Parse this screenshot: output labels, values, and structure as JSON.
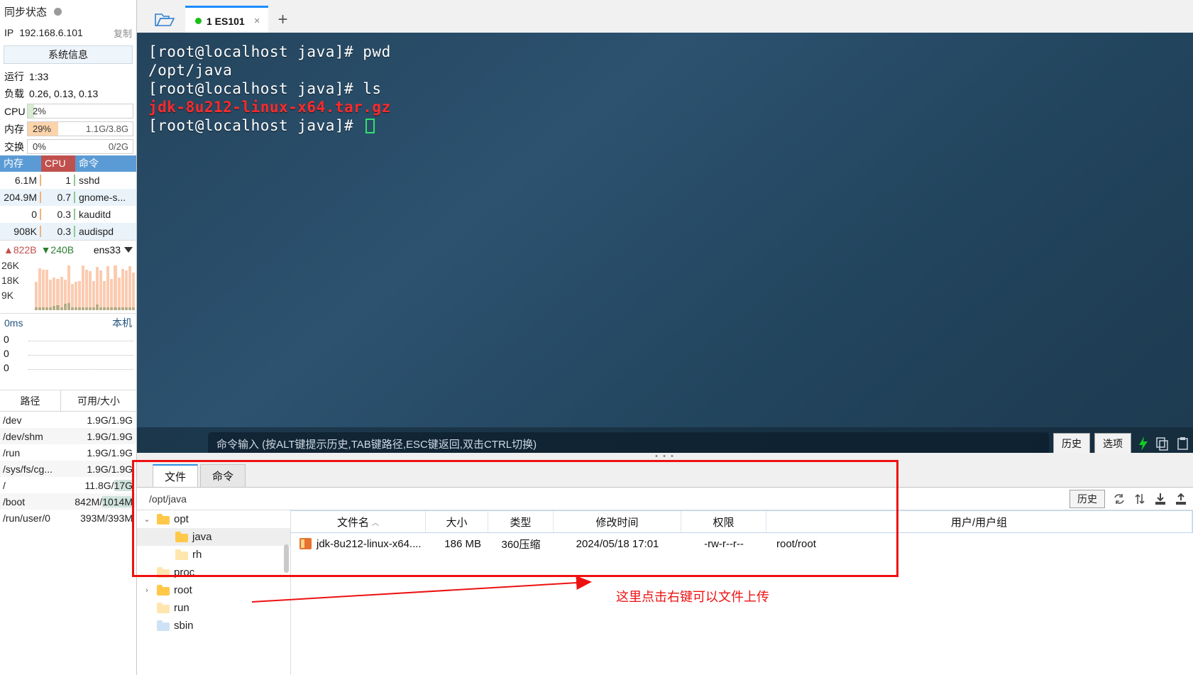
{
  "sidebar": {
    "sync_label": "同步状态",
    "ip_label": "IP",
    "ip_value": "192.168.6.101",
    "copy_label": "复制",
    "sysinfo_button": "系统信息",
    "uptime_label": "运行",
    "uptime_value": "1:33",
    "load_label": "负载",
    "load_value": "0.26, 0.13, 0.13",
    "meters": [
      {
        "label": "CPU",
        "pct": "2%",
        "right": "",
        "fill": "#d7ecd2",
        "width": "6%"
      },
      {
        "label": "内存",
        "pct": "29%",
        "right": "1.1G/3.8G",
        "fill": "#fbd4ab",
        "width": "29%"
      },
      {
        "label": "交换",
        "pct": "0%",
        "right": "0/2G",
        "fill": "#ffffff",
        "width": "0%"
      }
    ],
    "proc_headers": [
      "内存",
      "CPU",
      "命令"
    ],
    "processes": [
      {
        "mem": "6.1M",
        "cpu": "1",
        "cmd": "sshd"
      },
      {
        "mem": "204.9M",
        "cpu": "0.7",
        "cmd": "gnome-s..."
      },
      {
        "mem": "0",
        "cpu": "0.3",
        "cmd": "kauditd"
      },
      {
        "mem": "908K",
        "cpu": "0.3",
        "cmd": "audispd"
      }
    ],
    "net": {
      "up": "822B",
      "down": "240B",
      "interface": "ens33",
      "y_labels": [
        "26K",
        "18K",
        "9K"
      ]
    },
    "latency": {
      "unit": "0ms",
      "local_label": "本机",
      "y_labels": [
        "0",
        "0",
        "0"
      ]
    },
    "disk_headers": [
      "路径",
      "可用/大小"
    ],
    "disks": [
      {
        "path": "/dev",
        "size": "1.9G/1.9G",
        "hl": ""
      },
      {
        "path": "/dev/shm",
        "size": "1.9G/1.9G",
        "hl": ""
      },
      {
        "path": "/run",
        "size": "1.9G/1.9G",
        "hl": ""
      },
      {
        "path": "/sys/fs/cg...",
        "size": "1.9G/1.9G",
        "hl": ""
      },
      {
        "path": "/",
        "size": "11.8G/17G",
        "hl": "17G"
      },
      {
        "path": "/boot",
        "size": "842M/1014M",
        "hl": "1014M"
      },
      {
        "path": "/run/user/0",
        "size": "393M/393M",
        "hl": ""
      }
    ]
  },
  "tabbar": {
    "folder_icon": "open-folder-icon",
    "tab_label": "1 ES101",
    "close_icon": "×",
    "new_tab_icon": "+"
  },
  "terminal": {
    "lines": [
      {
        "text": "[root@localhost java]# pwd",
        "color": "white"
      },
      {
        "text": "/opt/java",
        "color": "white"
      },
      {
        "text": "[root@localhost java]# ls",
        "color": "white"
      },
      {
        "text": "jdk-8u212-linux-x64.tar.gz",
        "color": "red"
      },
      {
        "text": "[root@localhost java]# ",
        "color": "white"
      }
    ],
    "input_placeholder": "命令输入 (按ALT键提示历史,TAB键路径,ESC键返回,双击CTRL切换)",
    "history_button": "历史",
    "options_button": "选项"
  },
  "filepanel": {
    "tabs": [
      {
        "label": "文件",
        "active": true
      },
      {
        "label": "命令",
        "active": false
      }
    ],
    "path": "/opt/java",
    "history_button": "历史",
    "toolbar_icons": [
      "refresh-icon",
      "sync-icon",
      "download-icon",
      "upload-icon"
    ],
    "tree": [
      {
        "label": "opt",
        "indent": 0,
        "twisty": "v",
        "selected": false,
        "style": "normal"
      },
      {
        "label": "java",
        "indent": 1,
        "twisty": "",
        "selected": true,
        "style": "normal"
      },
      {
        "label": "rh",
        "indent": 1,
        "twisty": "",
        "selected": false,
        "style": "pale"
      },
      {
        "label": "proc",
        "indent": 0,
        "twisty": "",
        "selected": false,
        "style": "pale"
      },
      {
        "label": "root",
        "indent": 0,
        "twisty": ">",
        "selected": false,
        "style": "normal"
      },
      {
        "label": "run",
        "indent": 0,
        "twisty": "",
        "selected": false,
        "style": "pale"
      },
      {
        "label": "sbin",
        "indent": 0,
        "twisty": "",
        "selected": false,
        "style": "blue"
      }
    ],
    "columns": [
      "文件名",
      "大小",
      "类型",
      "修改时间",
      "权限",
      "用户/用户组"
    ],
    "sort_indicator": "︿",
    "files": [
      {
        "name": "jdk-8u212-linux-x64....",
        "size": "186 MB",
        "type": "360压缩",
        "mtime": "2024/05/18 17:01",
        "perm": "-rw-r--r--",
        "owner": "root/root"
      }
    ]
  },
  "annotation": {
    "text": "这里点击右键可以文件上传",
    "color": "#ee1111"
  }
}
